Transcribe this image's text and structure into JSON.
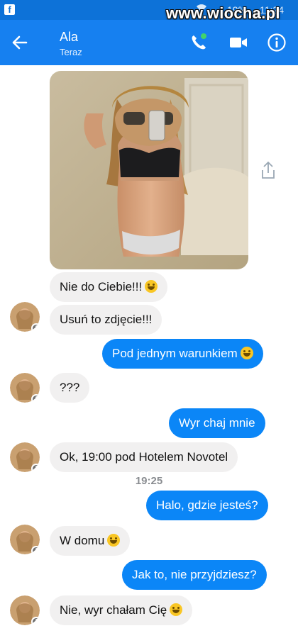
{
  "status_bar": {
    "fb_glyph": "f",
    "battery": "19%",
    "time": "11:24",
    "watermark": "www.wiocha.pl"
  },
  "header": {
    "contact_name": "Ala",
    "contact_status": "Teraz",
    "back_icon": "arrow-left-icon",
    "call_icon": "phone-icon",
    "video_icon": "video-camera-icon",
    "info_icon": "info-icon"
  },
  "colors": {
    "header": "#1680f0",
    "status_bar": "#0d72d8",
    "outgoing_bubble": "#0b86f7",
    "incoming_bubble": "#f1f0f0",
    "online": "#42d26b"
  },
  "messages": [
    {
      "sender": "Ala",
      "text": "Nie do Ciebie!!!"
    },
    {
      "sender": "Ala",
      "text": "Usuń to zdjęcie!!!"
    },
    {
      "sender": "me",
      "text": "Pod jednym warunkiem"
    },
    {
      "sender": "Ala",
      "text": "???"
    },
    {
      "sender": "me",
      "text": "Wyr  chaj mnie"
    },
    {
      "sender": "Ala",
      "text": "Ok, 19:00 pod Hotelem Novotel"
    },
    {
      "sender": "me",
      "text": "Halo, gdzie jesteś?"
    },
    {
      "sender": "Ala",
      "text": "W domu"
    },
    {
      "sender": "me",
      "text": "Jak to, nie przyjdziesz?"
    },
    {
      "sender": "Ala",
      "text": "Nie, wyr  chałam Cię"
    }
  ],
  "timestamp": "19:25",
  "avatar_badge": "f"
}
